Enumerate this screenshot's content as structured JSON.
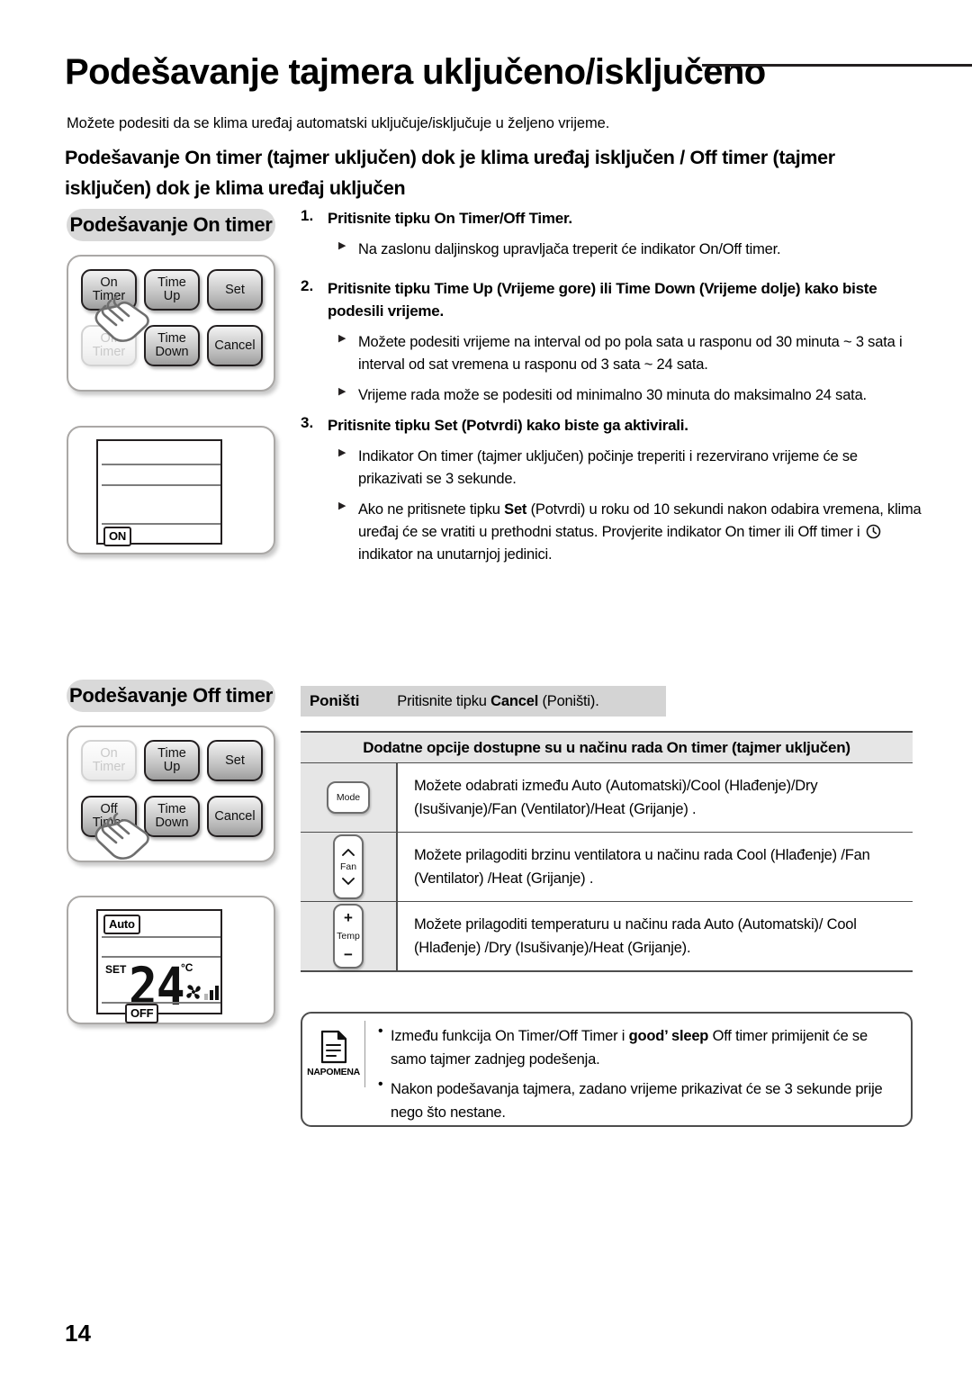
{
  "header": {
    "title": "Podešavanje tajmera uključeno/isključeno",
    "intro": "Možete podesiti da se klima uređaj automatski uključuje/isključuje u željeno vrijeme.",
    "subhead": "Podešavanje On timer (tajmer uključen) dok je klima uređaj isključen / Off timer (tajmer isključen) dok je klima uređaj uključen"
  },
  "sections": {
    "on_timer_pill": "Podešavanje On timer",
    "off_timer_pill": "Podešavanje Off timer"
  },
  "remote_keys": {
    "on_timer": "On\nTimer",
    "on_timer_l1": "On",
    "on_timer_l2": "Timer",
    "time_up_l1": "Time",
    "time_up_l2": "Up",
    "set": "Set",
    "off_timer_l1": "Off",
    "off_timer_l2": "Timer",
    "time_down_l1": "Time",
    "time_down_l2": "Down",
    "cancel": "Cancel"
  },
  "lcd_on": {
    "badge": "ON"
  },
  "lcd_off": {
    "mode_badge": "Auto",
    "set_label": "SET",
    "temperature": "24",
    "unit": "°C",
    "badge": "OFF"
  },
  "steps": [
    {
      "number": "1.",
      "title": "Pritisnite tipku On Timer/Off Timer.",
      "bullets": [
        "Na zaslonu daljinskog upravljača treperit će indikator On/Off timer."
      ]
    },
    {
      "number": "2.",
      "title": "Pritisnite tipku Time Up (Vrijeme gore) ili Time Down (Vrijeme dolje) kako biste podesili vrijeme.",
      "bullets": [
        "Možete podesiti vrijeme na interval od po pola sata u rasponu od 30 minuta ~ 3 sata i interval od sat vremena u rasponu od 3 sata ~ 24 sata.",
        "Vrijeme rada može se podesiti od minimalno 30 minuta do maksimalno 24 sata."
      ]
    },
    {
      "number": "3.",
      "title": "Pritisnite tipku Set (Potvrdi) kako biste ga aktivirali.",
      "bullets": [
        "Indikator On timer (tajmer uključen) počinje treperiti i rezervirano vrijeme će se prikazivati se 3 sekunde."
      ]
    }
  ],
  "step3_bullet2": {
    "pre": "Ako ne pritisnete tipku ",
    "bold": "Set",
    "mid": " (Potvrdi) u roku od 10 sekundi nakon odabira vremena, klima uređaj će se vratiti u prethodni status. Provjerite indikator On timer ili Off timer i ",
    "post": " indikator na unutarnjoj jedinici."
  },
  "cancel_row": {
    "label": "Poništi",
    "pre": "Pritisnite tipku ",
    "bold": "Cancel",
    "post": " (Poništi)."
  },
  "options_table": {
    "heading": "Dodatne opcije dostupne su u načinu rada On timer (tajmer uključen)",
    "rows": [
      {
        "icon_label": "Mode",
        "text": "Možete odabrati između Auto (Automatski)/Cool (Hlađenje)/Dry (Isušivanje)/Fan (Ventilator)/Heat (Grijanje) ."
      },
      {
        "icon_label": "Fan",
        "text": "Možete prilagoditi brzinu ventilatora u načinu rada Cool (Hlađenje) /Fan (Ventilator) /Heat (Grijanje) ."
      },
      {
        "icon_label": "Temp",
        "icon_plus": "+",
        "icon_minus": "−",
        "text": "Možete prilagoditi temperaturu u načinu rada Auto (Automatski)/ Cool (Hlađenje) /Dry (Isušivanje)/Heat (Grijanje)."
      }
    ]
  },
  "note": {
    "caption": "NAPOMENA",
    "item1_pre": "Između funkcija On Timer/Off Timer i ",
    "item1_bold": "good’ sleep",
    "item1_post": " Off timer primijenit će se samo tajmer zadnjeg podešenja.",
    "item2": "Nakon podešavanja tajmera, zadano vrijeme prikazivat će se 3 sekunde prije nego što nestane."
  },
  "footer": {
    "page_number": "14"
  },
  "colors": {
    "pill_bg": "#d9d9d9",
    "band_bg": "#d4d4d4",
    "table_head_bg": "#e6e6e6",
    "rule": "#231f20"
  }
}
